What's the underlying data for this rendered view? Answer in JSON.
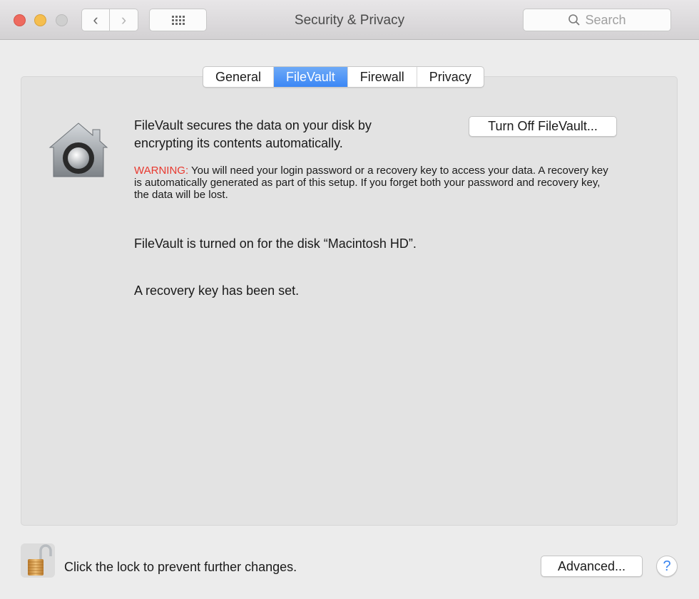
{
  "window": {
    "title": "Security & Privacy",
    "search_placeholder": "Search",
    "nav": {
      "back": "‹",
      "forward": "›"
    }
  },
  "tabs": [
    {
      "label": "General",
      "active": false
    },
    {
      "label": "FileVault",
      "active": true
    },
    {
      "label": "Firewall",
      "active": false
    },
    {
      "label": "Privacy",
      "active": false
    }
  ],
  "filevault": {
    "intro": "FileVault secures the data on your disk by encrypting its contents automatically.",
    "turn_off_button": "Turn Off FileVault...",
    "warning_label": "WARNING:",
    "warning_text": " You will need your login password or a recovery key to access your data. A recovery key is automatically generated as part of this setup. If you forget both your password and recovery key, the data will be lost.",
    "status_on": "FileVault is turned on for the disk “Macintosh HD”.",
    "status_key": "A recovery key has been set."
  },
  "footer": {
    "lock_text": "Click the lock to prevent further changes.",
    "advanced_button": "Advanced...",
    "help_button": "?"
  },
  "colors": {
    "accent": "#3b87f5",
    "warning": "#e8392f"
  }
}
